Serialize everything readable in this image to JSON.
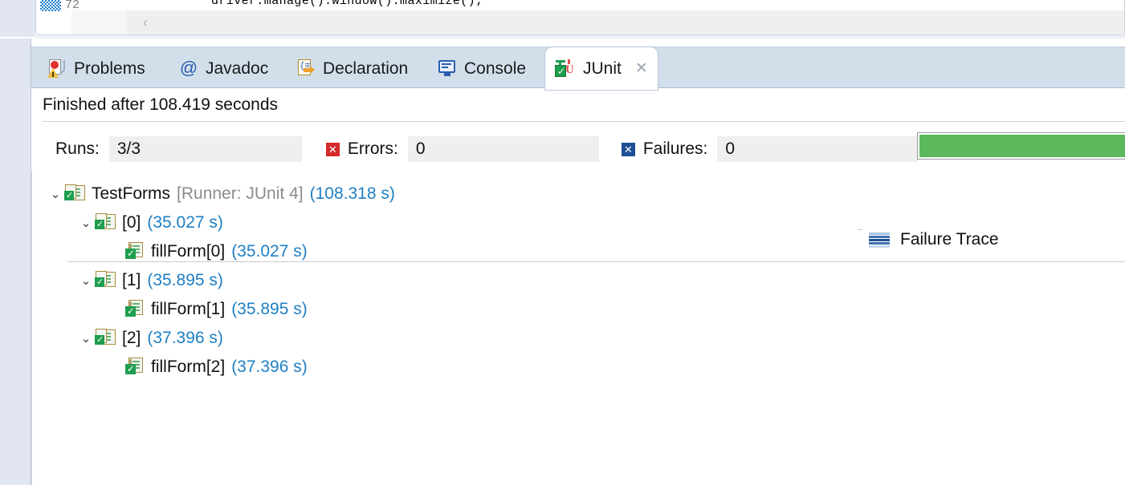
{
  "editor": {
    "line_number": "72",
    "code_line": "driver.manage().window().maximize();",
    "scroll_left_glyph": "‹",
    "annotation_name": "occurrence-annotation"
  },
  "tabs": [
    {
      "label": "Problems",
      "icon": "problems-icon",
      "active": false
    },
    {
      "label": "Javadoc",
      "icon": "at-icon",
      "active": false
    },
    {
      "label": "Declaration",
      "icon": "declaration-icon",
      "active": false
    },
    {
      "label": "Console",
      "icon": "console-icon",
      "active": false
    },
    {
      "label": "JUnit",
      "icon": "junit-icon",
      "active": true,
      "close_glyph": "✕"
    }
  ],
  "status": {
    "text": "Finished after 108.419 seconds"
  },
  "counters": {
    "runs_label": "Runs:",
    "runs_value": "3/3",
    "errors_label": "Errors:",
    "errors_value": "0",
    "errors_icon": "error-square-icon",
    "failures_label": "Failures:",
    "failures_value": "0",
    "failures_icon": "failure-square-icon",
    "icon_glyph": "✕"
  },
  "progress": {
    "percent": 100,
    "color": "#5cb85c",
    "state": "passed"
  },
  "tree": {
    "collapse_glyph": "⌄",
    "nodes": [
      {
        "label": "TestForms",
        "runner": "[Runner: JUnit 4]",
        "time": "(108.318 s)",
        "icon": "test-suite-icon",
        "depth": 0,
        "expanded": true,
        "selected": false
      },
      {
        "label": "[0]",
        "runner": "",
        "time": "(35.027 s)",
        "icon": "test-suite-icon",
        "depth": 1,
        "expanded": true,
        "selected": false
      },
      {
        "label": "fillForm[0]",
        "runner": "",
        "time": "(35.027 s)",
        "icon": "test-method-icon",
        "depth": 2,
        "expanded": null,
        "selected": false
      },
      {
        "label": "[1]",
        "runner": "",
        "time": "(35.895 s)",
        "icon": "test-suite-icon",
        "depth": 1,
        "expanded": true,
        "selected": false
      },
      {
        "label": "fillForm[1]",
        "runner": "",
        "time": "(35.895 s)",
        "icon": "test-method-icon",
        "depth": 2,
        "expanded": null,
        "selected": false
      },
      {
        "label": "[2]",
        "runner": "",
        "time": "(37.396 s)",
        "icon": "test-suite-icon",
        "depth": 1,
        "expanded": true,
        "selected": false
      },
      {
        "label": "fillForm[2]",
        "runner": "",
        "time": "(37.396 s)",
        "icon": "test-method-icon",
        "depth": 2,
        "expanded": null,
        "selected": true
      }
    ]
  },
  "failure_trace": {
    "title": "Failure Trace",
    "icon": "failure-trace-icon",
    "entries": []
  },
  "colors": {
    "accent_blue": "#1e7fc4",
    "tab_strip": "#d2dfeb",
    "progress_green": "#5cb85c",
    "selection": "#cfe4f7",
    "error_red": "#d42b2b",
    "failure_blue": "#1f4e96"
  }
}
